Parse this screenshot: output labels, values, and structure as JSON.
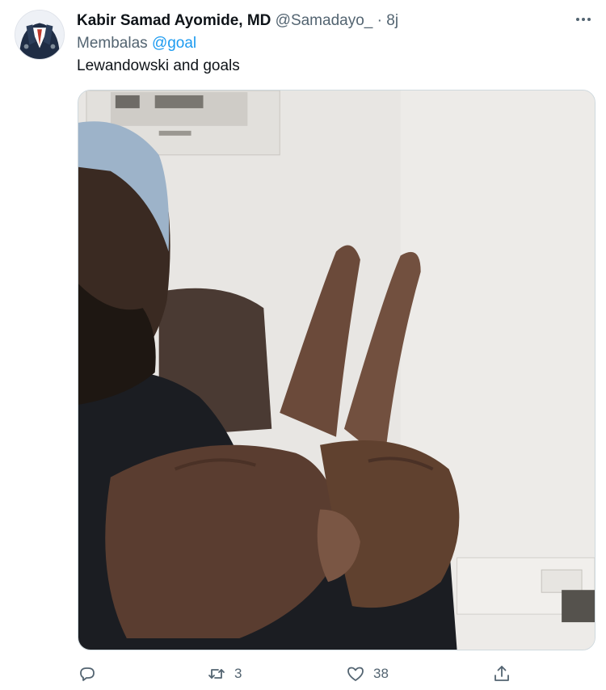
{
  "author": {
    "display_name": "Kabir Samad Ayomide, MD",
    "handle": "@Samadayo_",
    "separator": "·",
    "time": "8j"
  },
  "reply": {
    "prefix": "Membalas",
    "mention": "@goal"
  },
  "tweet": {
    "text": "Lewandowski and goals"
  },
  "actions": {
    "reply_icon": "reply-icon",
    "retweet_icon": "retweet-icon",
    "retweet_count": "3",
    "like_icon": "heart-icon",
    "like_count": "38",
    "share_icon": "share-icon"
  },
  "colors": {
    "accent": "#1d9bf0",
    "secondary_text": "#536471",
    "primary_text": "#0f1419"
  }
}
